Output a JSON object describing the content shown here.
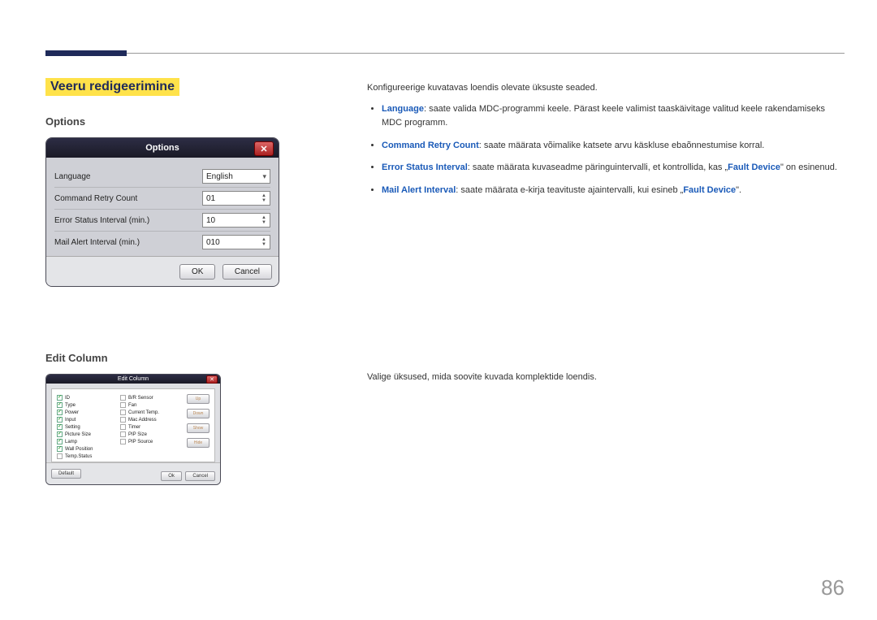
{
  "section_title": "Veeru redigeerimine",
  "options": {
    "heading": "Options",
    "dialog_title": "Options",
    "rows": [
      {
        "label": "Language",
        "value": "English",
        "type": "dropdown"
      },
      {
        "label": "Command Retry Count",
        "value": "01",
        "type": "spinner"
      },
      {
        "label": "Error Status Interval (min.)",
        "value": "10",
        "type": "spinner"
      },
      {
        "label": "Mail Alert Interval (min.)",
        "value": "010",
        "type": "spinner"
      }
    ],
    "ok": "OK",
    "cancel": "Cancel"
  },
  "edit_column": {
    "heading": "Edit Column",
    "dialog_title": "Edit Column",
    "left": [
      {
        "label": "ID",
        "checked": true
      },
      {
        "label": "Type",
        "checked": true
      },
      {
        "label": "Power",
        "checked": true
      },
      {
        "label": "Input",
        "checked": true
      },
      {
        "label": "Setting",
        "checked": true
      },
      {
        "label": "Picture Size",
        "checked": true
      },
      {
        "label": "Lamp",
        "checked": true
      },
      {
        "label": "Wall Position",
        "checked": true
      },
      {
        "label": "Temp.Status",
        "checked": false
      }
    ],
    "right": [
      {
        "label": "B/R Sensor",
        "checked": false
      },
      {
        "label": "Fan",
        "checked": false
      },
      {
        "label": "Current Temp.",
        "checked": false
      },
      {
        "label": "Mac Address",
        "checked": false
      },
      {
        "label": "Timer",
        "checked": false
      },
      {
        "label": "PIP Size",
        "checked": false
      },
      {
        "label": "PIP Source",
        "checked": false
      }
    ],
    "side_buttons": [
      "Up",
      "Down",
      "Show",
      "Hide"
    ],
    "default": "Default",
    "ok": "Ok",
    "cancel": "Cancel"
  },
  "text": {
    "intro": "Konfigureerige kuvatavas loendis olevate üksuste seaded.",
    "bullets": [
      {
        "bold": "Language",
        "rest": ": saate valida MDC-programmi keele. Pärast keele valimist taaskäivitage valitud keele rakendamiseks MDC programm."
      },
      {
        "bold": "Command Retry Count",
        "rest": ": saate määrata võimalike katsete arvu käskluse ebaõnnestumise korral."
      },
      {
        "bold": "Error Status Interval",
        "rest_before_fault": ": saate määrata kuvaseadme päringuintervalli, et kontrollida, kas „",
        "fault": "Fault Device",
        "rest_after_fault": "\" on esinenud."
      },
      {
        "bold": "Mail Alert Interval",
        "rest_before_fault": ": saate määrata e-kirja teavituste ajaintervalli, kui esineb „",
        "fault": "Fault Device",
        "rest_after_fault": "\"."
      }
    ],
    "second_intro": "Valige üksused, mida soovite kuvada komplektide loendis."
  },
  "page_number": "86"
}
